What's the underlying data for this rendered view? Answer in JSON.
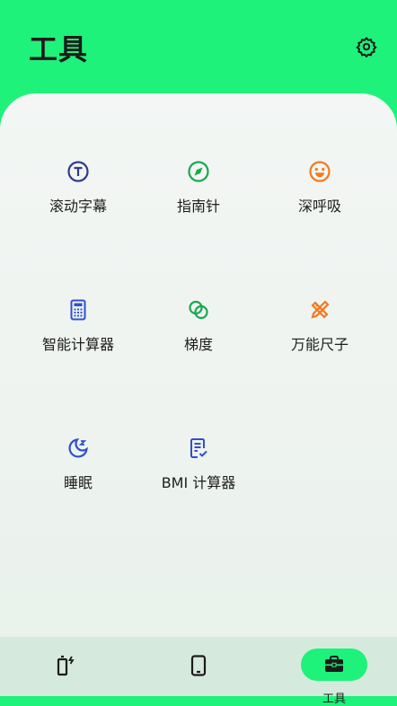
{
  "header": {
    "title": "工具"
  },
  "tools": [
    {
      "label": "滚动字幕",
      "icon": "marquee-t-icon"
    },
    {
      "label": "指南针",
      "icon": "compass-icon"
    },
    {
      "label": "深呼吸",
      "icon": "smile-icon"
    },
    {
      "label": "智能计算器",
      "icon": "calculator-icon"
    },
    {
      "label": "梯度",
      "icon": "gradient-circles-icon"
    },
    {
      "label": "万能尺子",
      "icon": "ruler-pencil-icon"
    },
    {
      "label": "睡眠",
      "icon": "moon-sleep-icon"
    },
    {
      "label": "BMI 计算器",
      "icon": "bmi-document-icon"
    }
  ],
  "bottom_nav": {
    "items": [
      {
        "icon": "battery-charge-icon"
      },
      {
        "icon": "phone-icon"
      },
      {
        "icon": "toolbox-icon",
        "label": "工具"
      }
    ]
  },
  "colors": {
    "accent": "#1ef27a",
    "blue": "#2f4fd1",
    "green": "#1aa84f",
    "orange": "#f37a1f"
  }
}
